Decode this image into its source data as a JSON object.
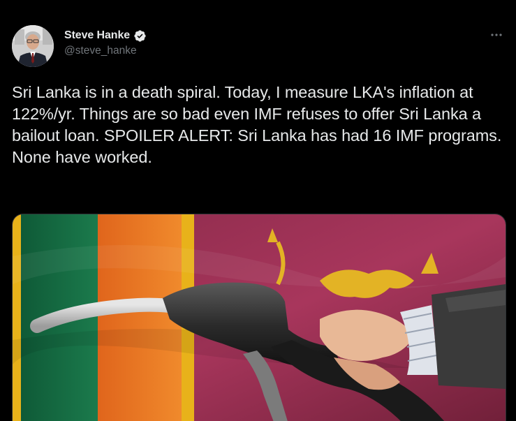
{
  "author": {
    "name": "Steve Hanke",
    "handle": "@steve_hanke",
    "verified": true,
    "avatar_icon": "person-photo-avatar"
  },
  "menu": {
    "icon": "more-horizontal-icon"
  },
  "tweet": {
    "text": "Sri Lanka is in a death spiral. Today, I measure LKA's inflation at 122%/yr. Things are so bad even IMF refuses to offer Sri Lanka a bailout loan. SPOILER ALERT: Sri Lanka has had 16 IMF programs. None have worked."
  },
  "media": {
    "image_subject": "fuel-nozzle-over-sri-lanka-flag"
  },
  "colors": {
    "background": "#000000",
    "text": "#e7e9ea",
    "secondary": "#71767b",
    "verified": "#1d9bf0"
  }
}
